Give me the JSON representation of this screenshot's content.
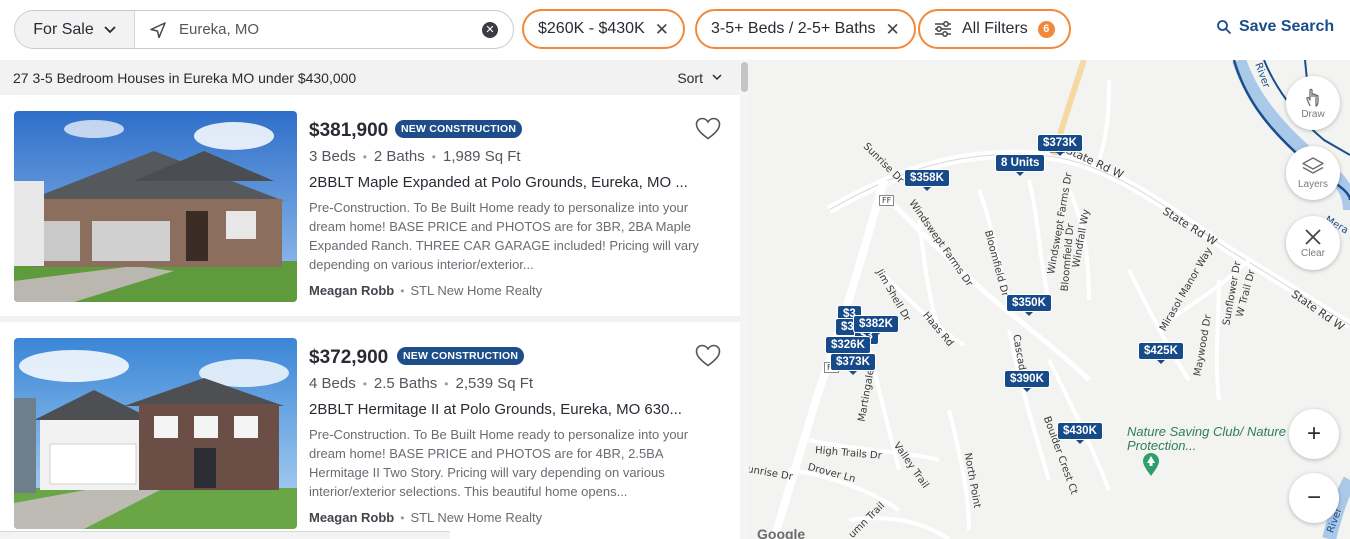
{
  "search": {
    "mode_label": "For Sale",
    "location_value": "Eureka, MO"
  },
  "filters": {
    "price_label": "$260K - $430K",
    "beds_baths_label": "3-5+ Beds / 2-5+ Baths",
    "all_filters_label": "All Filters",
    "all_filters_count": "6"
  },
  "save_search_label": "Save Search",
  "results": {
    "summary": "27 3-5 Bedroom Houses in Eureka MO under $430,000",
    "sort_label": "Sort"
  },
  "listings": [
    {
      "price": "$381,900",
      "badge": "NEW CONSTRUCTION",
      "beds": "3 Beds",
      "baths": "2 Baths",
      "sqft": "1,989 Sq Ft",
      "address": "2BBLT Maple Expanded at Polo Grounds, Eureka, MO ...",
      "description": "Pre-Construction. To Be Built Home ready to personalize into your dream home! BASE PRICE and PHOTOS are for 3BR, 2BA Maple Expanded Ranch. THREE CAR GARAGE included! Pricing will vary depending on various interior/exterior...",
      "agent": "Meagan Robb",
      "company": "STL New Home Realty"
    },
    {
      "price": "$372,900",
      "badge": "NEW CONSTRUCTION",
      "beds": "4 Beds",
      "baths": "2.5 Baths",
      "sqft": "2,539 Sq Ft",
      "address": "2BBLT Hermitage II at Polo Grounds, Eureka, MO 630...",
      "description": "Pre-Construction. To Be Built Home ready to personalize into your dream home! BASE PRICE and PHOTOS are for 4BR, 2.5BA Hermitage II Two Story. Pricing will vary depending on various interior/exterior selections. This beautiful home opens...",
      "agent": "Meagan Robb",
      "company": "STL New Home Realty"
    }
  ],
  "map": {
    "markers": {
      "m373a": "$373K",
      "units": "8 Units",
      "m358": "$358K",
      "m350": "$350K",
      "m425": "$425K",
      "m390": "$390K",
      "m430": "$430K",
      "m382": "$382K",
      "m326": "$326K",
      "m373b": "$373K",
      "m3a": "$3",
      "m3b": "$3",
      "m3c": "$3"
    },
    "controls": {
      "draw": "Draw",
      "layers": "Layers",
      "clear": "Clear",
      "zoom_in": "+",
      "zoom_out": "−"
    },
    "roads": {
      "state_rd_w1": "State Rd W",
      "state_rd_w2": "State Rd W",
      "state_rd_w3": "State Rd W",
      "sunrise": "Sunrise Dr",
      "windswept": "Windswept Farms Dr",
      "bloomfield": "Bloomfield Dr",
      "windswept2": "Windswept Farms Dr",
      "bloomfield2": "Bloomfield Dr",
      "windfall": "Windfall Wy",
      "jim_shell": "Jim Shell Dr",
      "haas": "Haas Rd",
      "mirasol": "Mirasol Manor Way",
      "sunflower": "Sunflower Dr",
      "wtrail": "W Trail Dr",
      "maywood": "Maywood Dr",
      "martingale": "Martingale",
      "cascade": "Cascade",
      "boulder": "Boulder Crest Ct",
      "high_trails": "High Trails Dr",
      "valley": "Valley Trail",
      "north_point": "North Point",
      "drover": "Drover Ln",
      "sunrise2": "unrise Dr",
      "autumn": "umn Trail",
      "river1": "River",
      "river2": "River",
      "mera": "Mera",
      "ff1": "FF",
      "ff2": "FF",
      "ff3": "FF",
      "ff4": "FF"
    },
    "poi": "Nature Saving Club/ Nature Protection...",
    "attribution": "Google"
  },
  "colors": {
    "accent_orange": "#f2893a",
    "brand_blue": "#1b4d8c",
    "marker_blue": "#164a88"
  }
}
